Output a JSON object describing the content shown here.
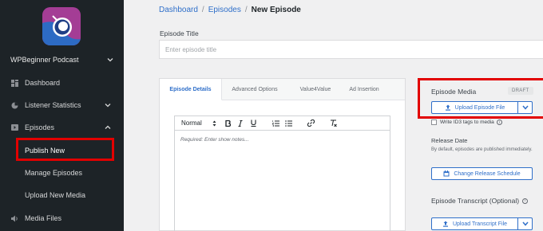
{
  "sidebar": {
    "podcast_name": "WPBeginner Podcast",
    "items": [
      {
        "label": "Dashboard",
        "icon": "dashboard-icon"
      },
      {
        "label": "Listener Statistics",
        "icon": "stats-icon"
      },
      {
        "label": "Episodes",
        "icon": "episodes-icon"
      },
      {
        "label": "Media Files",
        "icon": "media-icon"
      }
    ],
    "episodes_sub": [
      {
        "label": "Publish New"
      },
      {
        "label": "Manage Episodes"
      },
      {
        "label": "Upload New Media"
      }
    ]
  },
  "breadcrumb": {
    "dashboard": "Dashboard",
    "episodes": "Episodes",
    "current": "New Episode",
    "separator": "/"
  },
  "episode_title": {
    "label": "Episode Title",
    "placeholder": "Enter episode title"
  },
  "tabs": [
    {
      "label": "Episode Details"
    },
    {
      "label": "Advanced Options"
    },
    {
      "label": "Value4Value"
    },
    {
      "label": "Ad Insertion"
    }
  ],
  "editor": {
    "format": "Normal",
    "placeholder": "Required: Enter show notes..."
  },
  "media": {
    "heading": "Episode Media",
    "badge": "DRAFT",
    "upload_button": "Upload Episode File",
    "id3_checkbox": "Write ID3 tags to media"
  },
  "release": {
    "heading": "Release Date",
    "description": "By default, episodes are published immediately.",
    "button": "Change Release Schedule"
  },
  "transcript": {
    "heading": "Episode Transcript (Optional)",
    "button": "Upload Transcript File"
  },
  "colors": {
    "sidebar_bg": "#1d2327",
    "accent": "#2f6fc9",
    "highlight": "#e20000"
  }
}
